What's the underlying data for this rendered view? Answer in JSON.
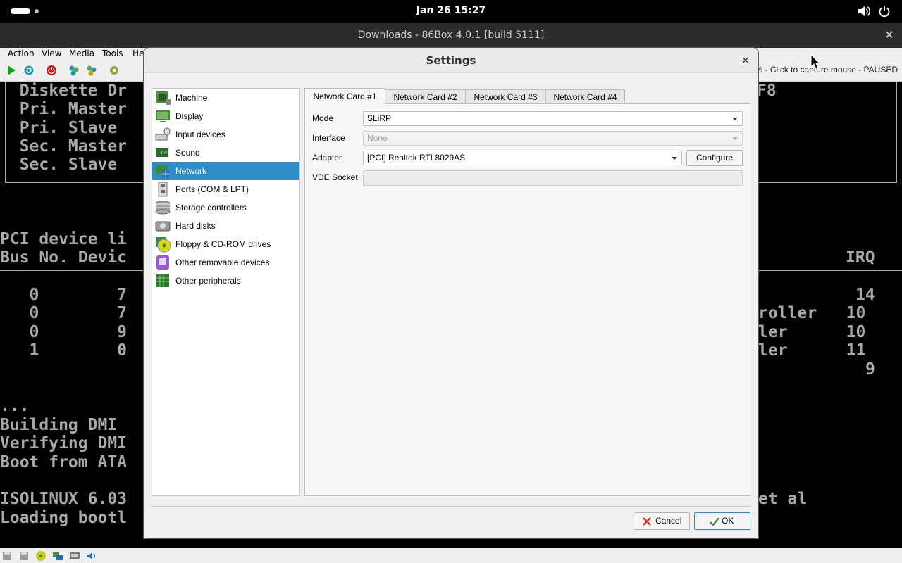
{
  "topbar": {
    "clock": "Jan 26  15:27",
    "icons": [
      "activities-pill-icon",
      "workspace-dot-icon",
      "volume-icon",
      "power-icon"
    ]
  },
  "main_window": {
    "title": "Downloads - 86Box 4.0.1 [build 5111]",
    "menu": [
      "Action",
      "View",
      "Media",
      "Tools",
      "He"
    ],
    "toolbar_icons": [
      "play-icon",
      "reset-icon",
      "power-off-icon",
      "ctrl-alt-del-icon",
      "ctrl-alt-esc-icon",
      "settings-icon"
    ],
    "status_message": "% - Click to capture mouse - PAUSED",
    "statusbar_icons": [
      "floppy-icon",
      "floppy-2-icon",
      "cdrom-icon",
      "network-icon",
      "display-icon",
      "sound-icon"
    ]
  },
  "screen": {
    "lines_left": [
      "  Diskette Dr",
      "  Pri. Master",
      "  Pri. Slave ",
      "  Sec. Master",
      "  Sec. Slave ",
      "PCI device li",
      "Bus No. Devic",
      "   0        7",
      "   0        7",
      "   0        9",
      "   1        0",
      "...",
      "Building DMI ",
      "Verifying DMI",
      "Boot from ATA",
      "ISOLINUX 6.03",
      "Loading bootl"
    ],
    "lines_right": [
      "F8",
      "IRQ",
      "14",
      "roller   10",
      "ler      10",
      "ler      11",
      "9",
      "et al"
    ]
  },
  "dialog": {
    "title": "Settings",
    "categories": [
      {
        "label": "Machine",
        "icon": "machine-icon",
        "selected": false
      },
      {
        "label": "Display",
        "icon": "display-icon",
        "selected": false
      },
      {
        "label": "Input devices",
        "icon": "input-devices-icon",
        "selected": false
      },
      {
        "label": "Sound",
        "icon": "sound-icon",
        "selected": false
      },
      {
        "label": "Network",
        "icon": "network-icon",
        "selected": true
      },
      {
        "label": "Ports (COM & LPT)",
        "icon": "ports-icon",
        "selected": false
      },
      {
        "label": "Storage controllers",
        "icon": "storage-icon",
        "selected": false
      },
      {
        "label": "Hard disks",
        "icon": "hard-disk-icon",
        "selected": false
      },
      {
        "label": "Floppy & CD-ROM drives",
        "icon": "floppy-cdrom-icon",
        "selected": false
      },
      {
        "label": "Other removable devices",
        "icon": "removable-icon",
        "selected": false
      },
      {
        "label": "Other peripherals",
        "icon": "peripherals-icon",
        "selected": false
      }
    ],
    "tabs": [
      "Network Card #1",
      "Network Card #2",
      "Network Card #3",
      "Network Card #4"
    ],
    "active_tab": 0,
    "form": {
      "mode_label": "Mode",
      "mode_value": "SLiRP",
      "interface_label": "Interface",
      "interface_value": "None",
      "adapter_label": "Adapter",
      "adapter_value": "[PCI] Realtek RTL8029AS",
      "configure_label": "Configure",
      "vde_label": "VDE Socket",
      "vde_value": ""
    },
    "buttons": {
      "cancel": "Cancel",
      "ok": "OK"
    },
    "colors": {
      "selection": "#308cc6",
      "ok_border": "#3a82c4"
    }
  }
}
